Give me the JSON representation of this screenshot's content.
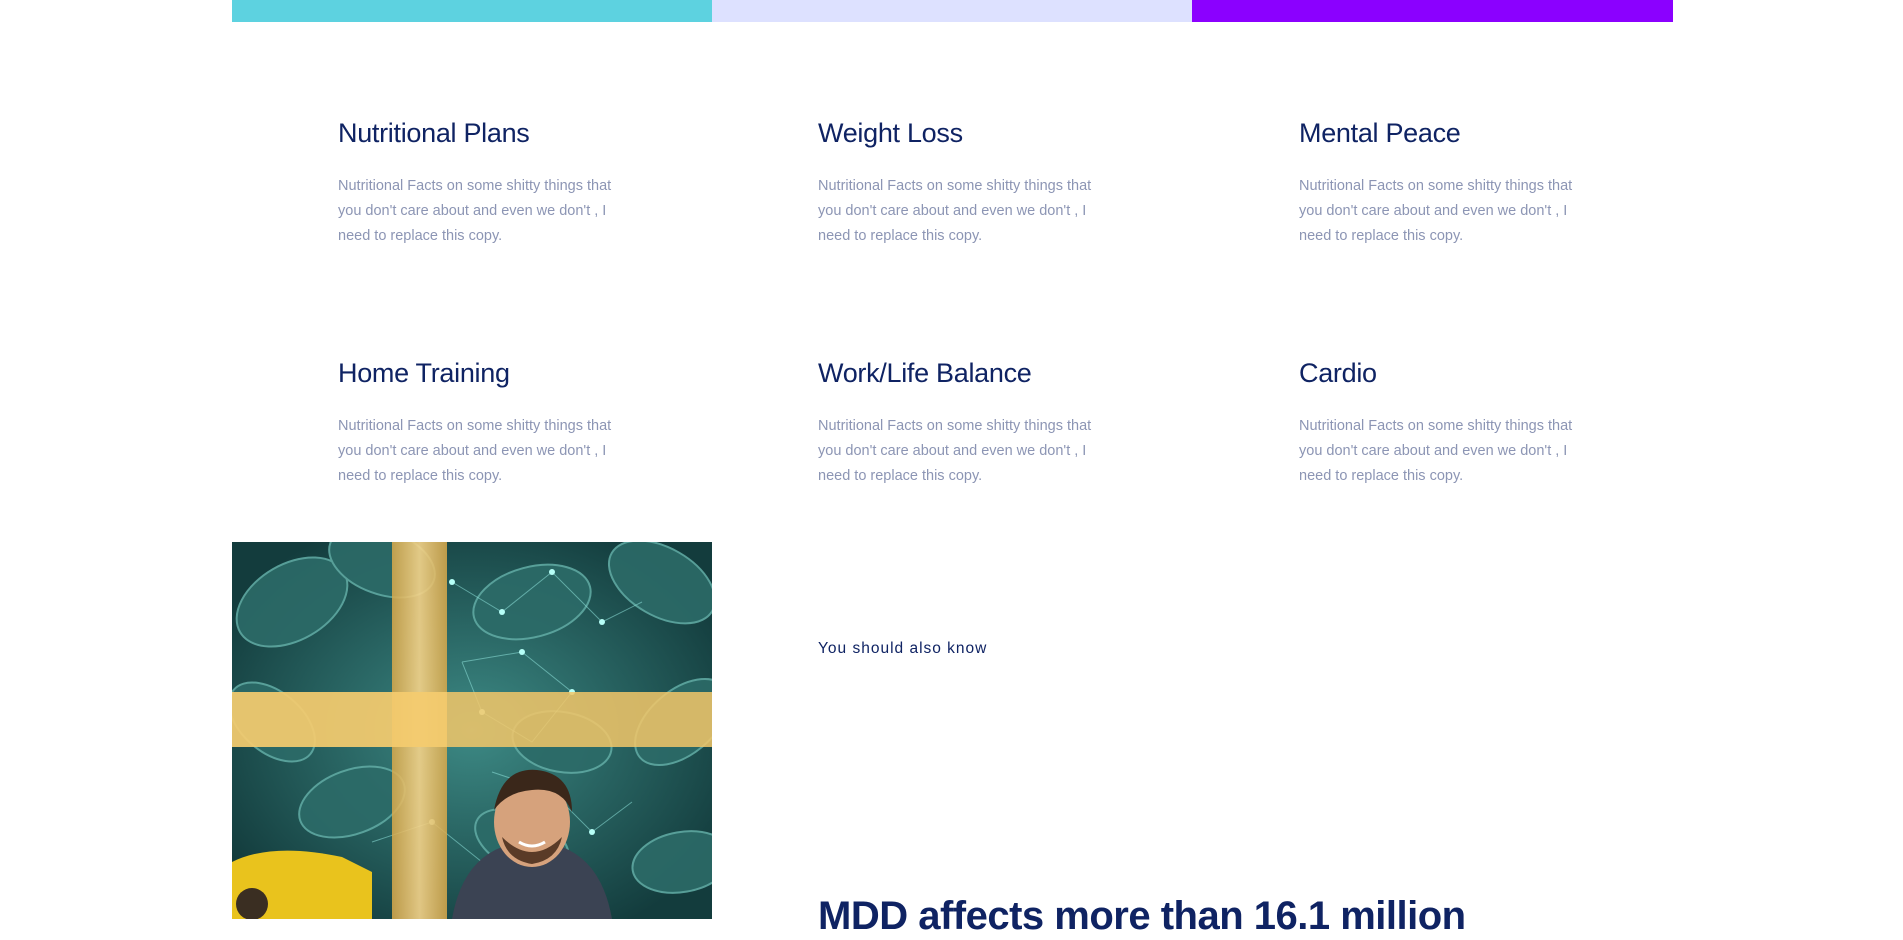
{
  "colors": {
    "bar_1": "#5dd2e0",
    "bar_2": "#dde1ff",
    "bar_3": "#8b00ff",
    "heading": "#0f2363",
    "body_text": "#8c95b4"
  },
  "features": [
    {
      "title": "Nutritional Plans",
      "desc": "Nutritional Facts on some shitty things that you don't care about and even we don't , I need to replace this copy."
    },
    {
      "title": "Weight Loss",
      "desc": "Nutritional Facts on some shitty things that you don't care about and even we don't , I need to replace this copy."
    },
    {
      "title": "Mental Peace",
      "desc": "Nutritional Facts on some shitty things that you don't care about and even we don't , I need to replace this copy."
    },
    {
      "title": "Home Training",
      "desc": "Nutritional Facts on some shitty things that you don't care about and even we don't , I need to replace this copy."
    },
    {
      "title": "Work/Life Balance",
      "desc": "Nutritional Facts on some shitty things that you don't care about and even we don't , I need to replace this copy."
    },
    {
      "title": "Cardio",
      "desc": "Nutritional Facts on some shitty things that you don't care about and even we don't , I need to replace this copy."
    }
  ],
  "info": {
    "eyebrow": "You should also know",
    "headline": "MDD affects more than 16.1 million"
  }
}
